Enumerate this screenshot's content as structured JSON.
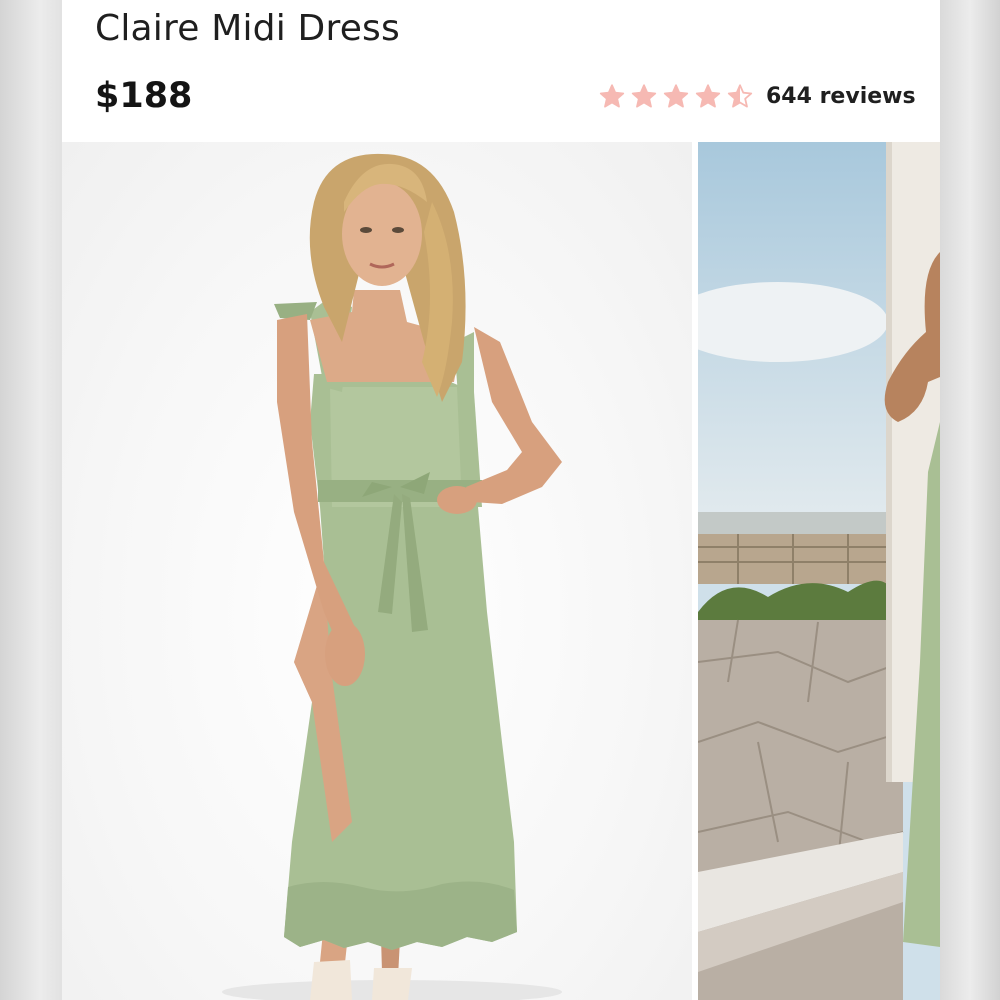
{
  "product": {
    "title": "Claire Midi Dress",
    "price": "$188",
    "rating": 4.5,
    "review_count_label": "644 reviews"
  },
  "colors": {
    "star": "#f6b9b3",
    "dress": "#a9bf94",
    "title_text": "#1f1f1f"
  },
  "icons": {
    "star": "star-icon"
  },
  "gallery": {
    "images": [
      {
        "name": "model-front-photo"
      },
      {
        "name": "model-outdoor-photo"
      }
    ]
  }
}
